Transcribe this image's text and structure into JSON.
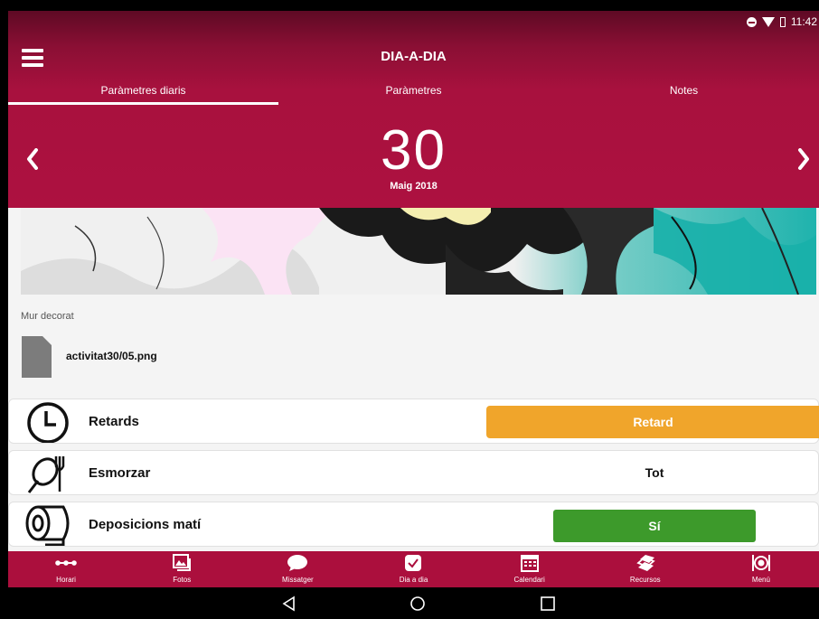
{
  "status_bar": {
    "time": "11:42"
  },
  "header": {
    "title": "DIA-A-DIA",
    "menu_icon": "hamburger-icon"
  },
  "tabs": [
    {
      "label": "Paràmetres diaris",
      "active": true
    },
    {
      "label": "Paràmetres",
      "active": false
    },
    {
      "label": "Notes",
      "active": false
    }
  ],
  "date": {
    "day": "30",
    "month_year": "Maig 2018",
    "prev_icon": "chevron-left-icon",
    "next_icon": "chevron-right-icon"
  },
  "wall": {
    "caption": "Mur decorat",
    "file_name": "activitat30/05.png"
  },
  "rows": [
    {
      "label": "Retards",
      "icon": "clock-icon",
      "value": "Retard",
      "style": "orange"
    },
    {
      "label": "Esmorzar",
      "icon": "plate-fork-icon",
      "value": "Tot",
      "style": "text"
    },
    {
      "label": "Deposicions matí",
      "icon": "toilet-paper-icon",
      "value": "Sí",
      "style": "green"
    }
  ],
  "bottom_nav": [
    {
      "label": "Horari",
      "icon": "timeline-icon"
    },
    {
      "label": "Fotos",
      "icon": "photos-icon"
    },
    {
      "label": "Missatger",
      "icon": "chat-bubble-icon"
    },
    {
      "label": "Dia a dia",
      "icon": "check-box-icon"
    },
    {
      "label": "Calendari",
      "icon": "calendar-icon"
    },
    {
      "label": "Recursos",
      "icon": "books-icon"
    },
    {
      "label": "Menú",
      "icon": "dish-icon"
    }
  ],
  "colors": {
    "brand": "#ab0f3d",
    "orange": "#f0a52b",
    "green": "#3d9a2b"
  }
}
